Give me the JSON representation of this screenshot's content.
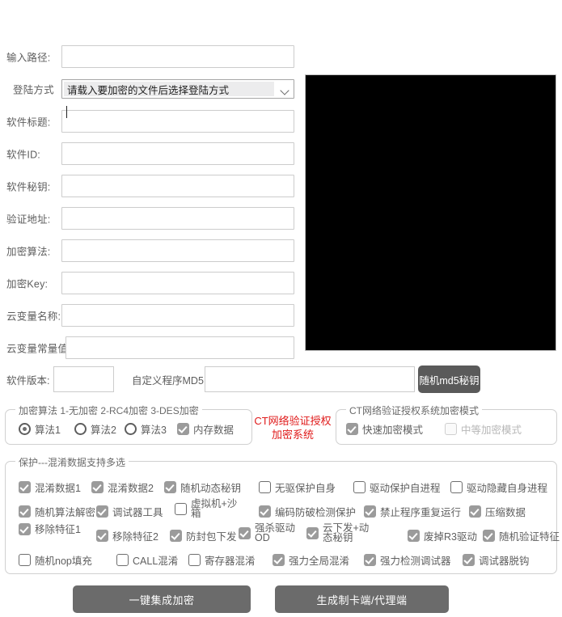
{
  "form": {
    "rows": [
      {
        "label": "输入路径:",
        "value": "",
        "type": "text"
      },
      {
        "label": "登陆方式",
        "value": "请载入要加密的文件后选择登陆方式",
        "type": "select"
      },
      {
        "label": "软件标题:",
        "value": "",
        "type": "text"
      },
      {
        "label": "软件ID:",
        "value": "",
        "type": "text"
      },
      {
        "label": "软件秘钥:",
        "value": "",
        "type": "text"
      },
      {
        "label": "验证地址:",
        "value": "",
        "type": "text"
      },
      {
        "label": "加密算法:",
        "value": "",
        "type": "text"
      },
      {
        "label": "加密Key:",
        "value": "",
        "type": "text"
      },
      {
        "label": "云变量名称:",
        "value": "",
        "type": "text"
      },
      {
        "label": "云变量常量值",
        "value": "",
        "type": "text"
      }
    ]
  },
  "version_row": {
    "version_label": "软件版本:",
    "version_value": "",
    "md5_label": "自定义程序MD5:",
    "md5_value": "",
    "md5_button": "随机md5秘钥"
  },
  "algorithm_group": {
    "legend": "加密算法 1-无加密 2-RC4加密 3-DES加密",
    "radios": [
      {
        "label": "算法1",
        "checked": true
      },
      {
        "label": "算法2",
        "checked": false
      },
      {
        "label": "算法3",
        "checked": false
      }
    ],
    "checkbox": {
      "label": "内存数据",
      "checked": true
    }
  },
  "red_title": "CT网络验证授权加密系统",
  "mode_group": {
    "legend": "CT网络验证授权系统加密模式",
    "items": [
      {
        "label": "快速加密模式",
        "checked": true,
        "disabled": false
      },
      {
        "label": "中等加密模式",
        "checked": false,
        "disabled": true
      }
    ]
  },
  "protection_group": {
    "legend": "保护---混淆数据支持多选",
    "rows": [
      [
        {
          "label": "混淆数据1",
          "checked": true
        },
        {
          "label": "混淆数据2",
          "checked": true
        },
        {
          "label": "随机动态秘钥",
          "checked": true
        },
        {
          "label": "无驱保护自身",
          "checked": false
        },
        {
          "label": "驱动保护自进程",
          "checked": false
        },
        {
          "label": "驱动隐藏自身进程",
          "checked": false
        }
      ],
      [
        {
          "label": "随机算法解密",
          "checked": true
        },
        {
          "label": "调试器工具",
          "checked": true
        },
        {
          "label": "虚拟机+沙箱",
          "checked": false
        },
        {
          "label": "编码防破检测保护",
          "checked": true
        },
        {
          "label": "禁止程序重复运行",
          "checked": true
        },
        {
          "label": "压缩数据",
          "checked": true
        }
      ],
      [
        {
          "label": "移除特征1",
          "checked": true
        },
        {
          "label": "移除特征2",
          "checked": true
        },
        {
          "label": "防封包下发",
          "checked": true
        },
        {
          "label": "强杀驱动OD",
          "checked": true
        },
        {
          "label": "云下发+动态秘钥",
          "checked": true
        },
        {
          "label": "废掉R3驱动",
          "checked": true
        },
        {
          "label": "随机验证特征",
          "checked": true
        }
      ],
      [
        {
          "label": "随机nop填充",
          "checked": false
        },
        {
          "label": "CALL混淆",
          "checked": false
        },
        {
          "label": "寄存器混淆",
          "checked": false
        },
        {
          "label": "强力全局混淆",
          "checked": true
        },
        {
          "label": "强力检测调试器",
          "checked": true
        },
        {
          "label": "调试器脱钩",
          "checked": true
        }
      ]
    ]
  },
  "buttons": {
    "encrypt": "一键集成加密",
    "generate": "生成制卡端/代理端"
  },
  "colors": {
    "accent_red": "#e01b1b",
    "button_gray": "#6b6b6b",
    "check_gray": "#9b9b9b",
    "panel_black": "#000000"
  }
}
